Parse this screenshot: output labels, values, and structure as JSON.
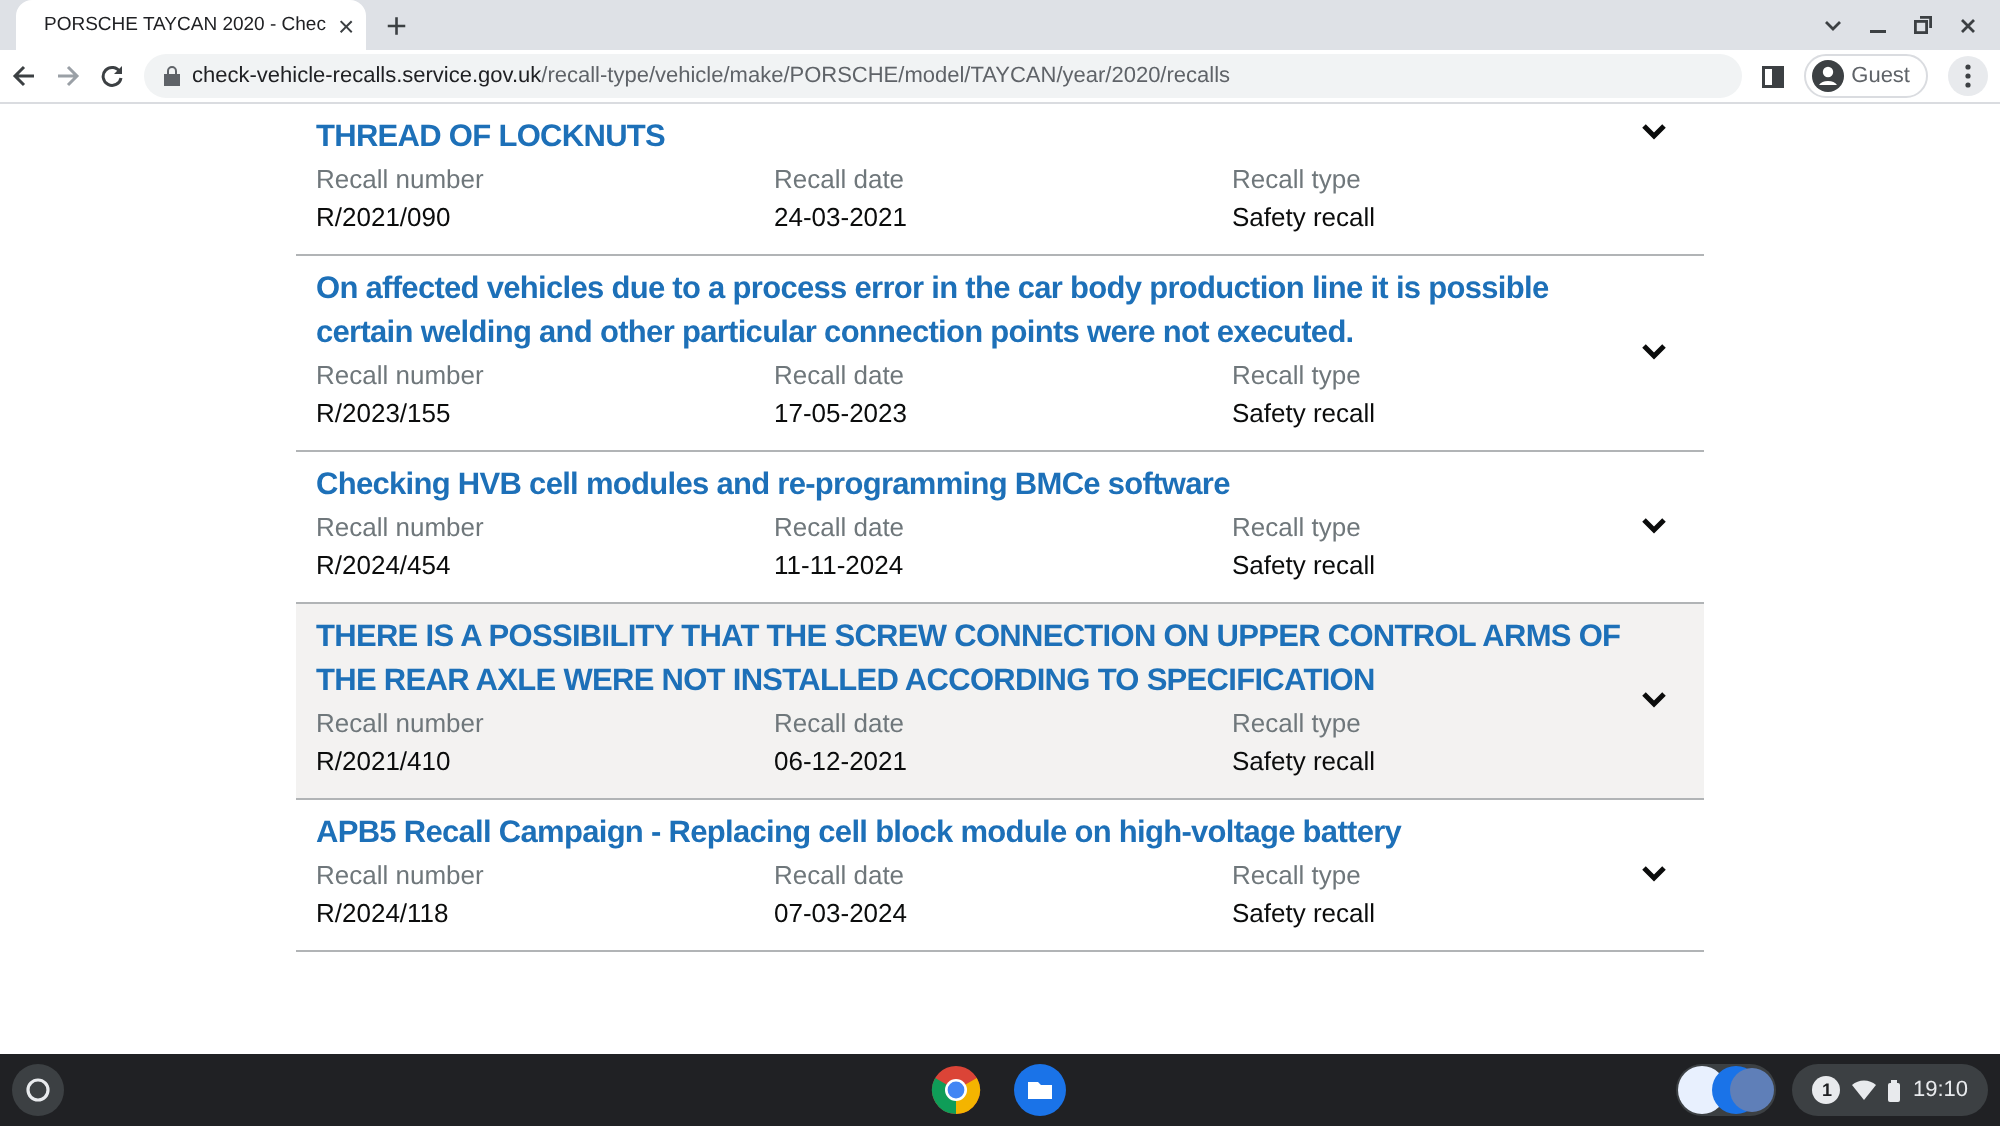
{
  "browser": {
    "tab": {
      "title": "PORSCHE TAYCAN 2020 - Chec",
      "close": "×"
    },
    "new_tab": "+",
    "url_host": "check-vehicle-recalls.service.gov.uk",
    "url_path": "/recall-type/vehicle/make/PORSCHE/model/TAYCAN/year/2020/recalls",
    "profile": "Guest"
  },
  "recalls": [
    {
      "title": "THREAD OF LOCKNUTS",
      "highlighted": false,
      "fields": [
        {
          "label": "Recall number",
          "value": "R/2021/090"
        },
        {
          "label": "Recall date",
          "value": "24-03-2021"
        },
        {
          "label": "Recall type",
          "value": "Safety recall"
        }
      ]
    },
    {
      "title": "On affected vehicles due to a process error in the car body production line it is possible certain welding and other particular connection points were not executed.",
      "highlighted": false,
      "fields": [
        {
          "label": "Recall number",
          "value": "R/2023/155"
        },
        {
          "label": "Recall date",
          "value": "17-05-2023"
        },
        {
          "label": "Recall type",
          "value": "Safety recall"
        }
      ]
    },
    {
      "title": "Checking HVB cell modules and re-programming BMCe software",
      "highlighted": false,
      "fields": [
        {
          "label": "Recall number",
          "value": "R/2024/454"
        },
        {
          "label": "Recall date",
          "value": "11-11-2024"
        },
        {
          "label": "Recall type",
          "value": "Safety recall"
        }
      ]
    },
    {
      "title": "THERE IS A POSSIBILITY THAT THE SCREW CONNECTION ON UPPER CONTROL ARMS OF THE REAR AXLE WERE NOT INSTALLED ACCORDING TO SPECIFICATION",
      "highlighted": true,
      "fields": [
        {
          "label": "Recall number",
          "value": "R/2021/410"
        },
        {
          "label": "Recall date",
          "value": "06-12-2021"
        },
        {
          "label": "Recall type",
          "value": "Safety recall"
        }
      ]
    },
    {
      "title": "APB5 Recall Campaign - Replacing cell block module on high-voltage battery",
      "highlighted": false,
      "fields": [
        {
          "label": "Recall number",
          "value": "R/2024/118"
        },
        {
          "label": "Recall date",
          "value": "07-03-2024"
        },
        {
          "label": "Recall type",
          "value": "Safety recall"
        }
      ]
    }
  ],
  "taskbar": {
    "notification_count": "1",
    "time": "19:10"
  }
}
